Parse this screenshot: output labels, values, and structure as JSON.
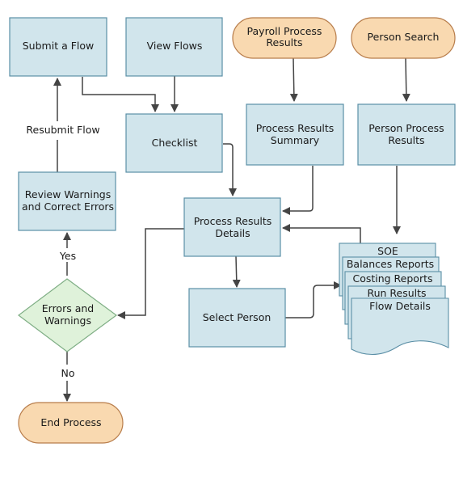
{
  "colors": {
    "process_fill": "#d1e5ec",
    "process_stroke": "#5b8fa6",
    "terminal_fill": "#f9d9b0",
    "terminal_stroke": "#b87d4b",
    "decision_fill": "#dff2da",
    "decision_stroke": "#7fae85",
    "connector": "#444444"
  },
  "nodes": {
    "submit_flow": "Submit a Flow",
    "view_flows": "View Flows",
    "payroll_process_results": [
      "Payroll Process",
      "Results"
    ],
    "person_search": "Person Search",
    "checklist": "Checklist",
    "process_results_summary": [
      "Process Results",
      "Summary"
    ],
    "person_process_results": [
      "Person Process",
      "Results"
    ],
    "review_warnings": [
      "Review Warnings",
      "and Correct Errors"
    ],
    "process_results_details": [
      "Process Results",
      "Details"
    ],
    "errors_and_warnings": [
      "Errors and",
      "Warnings"
    ],
    "select_person": "Select Person",
    "end_process": "End Process",
    "documents": [
      "SOE",
      "Balances Reports",
      "Costing Reports",
      "Run Results",
      "Flow Details"
    ]
  },
  "edge_labels": {
    "resubmit": "Resubmit Flow",
    "yes": "Yes",
    "no": "No"
  }
}
